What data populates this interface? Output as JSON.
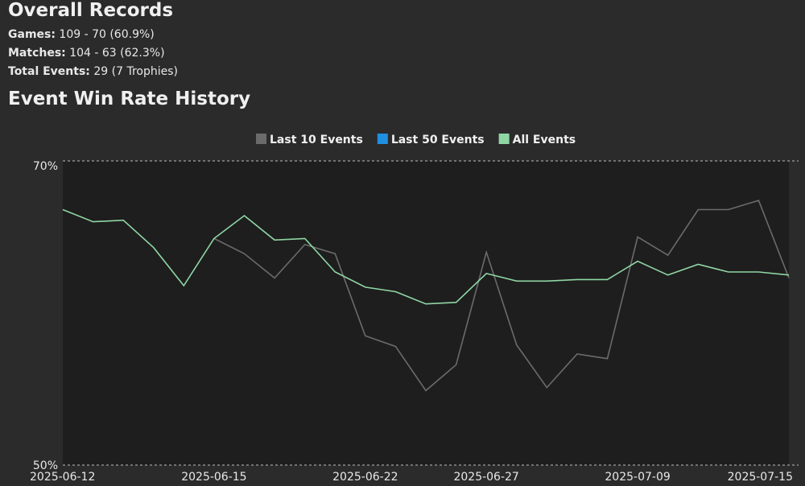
{
  "records": {
    "title": "Overall Records",
    "games_label": "Games:",
    "games_value": "109 - 70 (60.9%)",
    "matches_label": "Matches:",
    "matches_value": "104 - 63 (62.3%)",
    "events_label": "Total Events:",
    "events_value": "29 (7 Trophies)"
  },
  "history": {
    "title": "Event Win Rate History"
  },
  "colors": {
    "last10": "#6b6b6b",
    "last50": "#1f8fe0",
    "all": "#8fd6a4",
    "plot_bg": "#1e1e1e",
    "page_bg": "#2b2b2b"
  },
  "chart_data": {
    "type": "line",
    "title": "",
    "xlabel": "",
    "ylabel": "",
    "ylim": [
      50,
      70
    ],
    "y_ticks": [
      "70%",
      "50%"
    ],
    "x_ticks": [
      "2025-06-12",
      "2025-06-15",
      "2025-06-22",
      "2025-06-27",
      "2025-07-09",
      "2025-07-15"
    ],
    "legend": "top-center",
    "series": [
      {
        "name": "Last 10 Events",
        "color": "#6b6b6b",
        "values": [
          null,
          null,
          null,
          null,
          null,
          64.9,
          63.9,
          62.3,
          64.5,
          63.9,
          58.5,
          57.8,
          54.9,
          56.6,
          64.0,
          57.9,
          55.1,
          57.3,
          57.0,
          65.0,
          63.8,
          66.8,
          66.8,
          67.4,
          62.3
        ]
      },
      {
        "name": "Last 50 Events",
        "color": "#1f8fe0",
        "values": []
      },
      {
        "name": "All Events",
        "color": "#8fd6a4",
        "values": [
          66.8,
          66.0,
          66.1,
          64.3,
          61.8,
          64.9,
          66.4,
          64.8,
          64.9,
          62.7,
          61.7,
          61.4,
          60.6,
          60.7,
          62.6,
          62.1,
          62.1,
          62.2,
          62.2,
          63.4,
          62.5,
          63.2,
          62.7,
          62.7,
          62.5
        ]
      }
    ]
  }
}
